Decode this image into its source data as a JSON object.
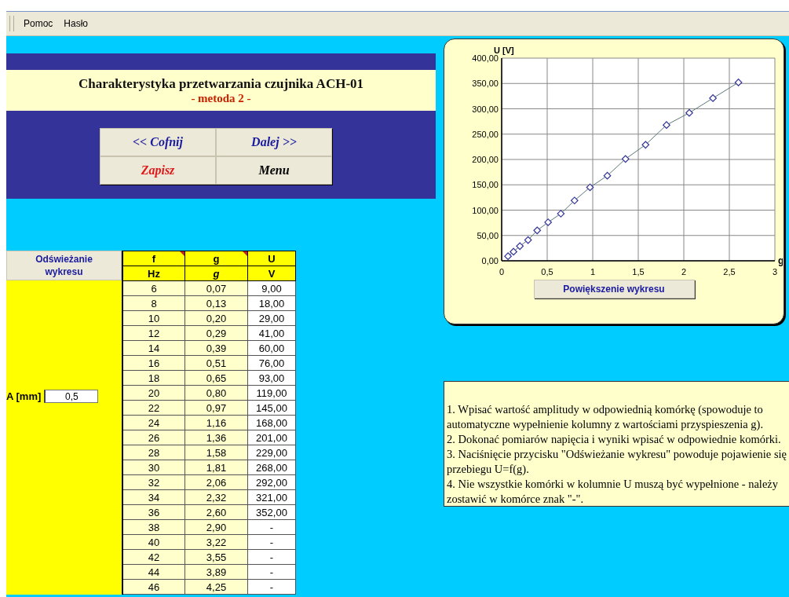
{
  "menu": [
    "Pomoc",
    "Hasło"
  ],
  "header": {
    "title": "Charakterystyka przetwarzania czujnika ACH-01",
    "subtitle": "- metoda 2 -"
  },
  "nav_buttons": [
    {
      "label": "<< Cofnij",
      "color": "#1a1aa0"
    },
    {
      "label": "Dalej >>",
      "color": "#1a1aa0"
    },
    {
      "label": "Zapisz",
      "color": "#e01818"
    },
    {
      "label": "Menu",
      "color": "#000000"
    }
  ],
  "refresh_button": "Odświeżanie wykresu",
  "amplitude": {
    "label": "A [mm]",
    "value": "0,5"
  },
  "table": {
    "columns": [
      {
        "name": "f",
        "unit": "Hz"
      },
      {
        "name": "g",
        "unit": "g"
      },
      {
        "name": "U",
        "unit": "V"
      }
    ],
    "rows": [
      [
        "6",
        "0,07",
        "9,00"
      ],
      [
        "8",
        "0,13",
        "18,00"
      ],
      [
        "10",
        "0,20",
        "29,00"
      ],
      [
        "12",
        "0,29",
        "41,00"
      ],
      [
        "14",
        "0,39",
        "60,00"
      ],
      [
        "16",
        "0,51",
        "76,00"
      ],
      [
        "18",
        "0,65",
        "93,00"
      ],
      [
        "20",
        "0,80",
        "119,00"
      ],
      [
        "22",
        "0,97",
        "145,00"
      ],
      [
        "24",
        "1,16",
        "168,00"
      ],
      [
        "26",
        "1,36",
        "201,00"
      ],
      [
        "28",
        "1,58",
        "229,00"
      ],
      [
        "30",
        "1,81",
        "268,00"
      ],
      [
        "32",
        "2,06",
        "292,00"
      ],
      [
        "34",
        "2,32",
        "321,00"
      ],
      [
        "36",
        "2,60",
        "352,00"
      ],
      [
        "38",
        "2,90",
        "-"
      ],
      [
        "40",
        "3,22",
        "-"
      ],
      [
        "42",
        "3,55",
        "-"
      ],
      [
        "44",
        "3,89",
        "-"
      ],
      [
        "46",
        "4,25",
        "-"
      ]
    ]
  },
  "chart": {
    "chart_data": {
      "type": "line",
      "xlabel": "g",
      "ylabel": "U [V]",
      "x": [
        0.07,
        0.13,
        0.2,
        0.29,
        0.39,
        0.51,
        0.65,
        0.8,
        0.97,
        1.16,
        1.36,
        1.58,
        1.81,
        2.06,
        2.32,
        2.6
      ],
      "series": [
        {
          "color": "#5a7a7a",
          "marker": "diamond",
          "values": [
            9,
            18,
            29,
            41,
            60,
            76,
            93,
            119,
            145,
            168,
            201,
            229,
            268,
            292,
            321,
            352
          ]
        }
      ],
      "grid": true,
      "xlim": [
        0,
        3
      ],
      "ylim": [
        0,
        400
      ],
      "xticks": [
        0,
        {
          "value": 0.5,
          "label": "0,5"
        },
        1,
        {
          "value": 1.5,
          "label": "1,5"
        },
        2,
        {
          "value": 2.5,
          "label": "2,5"
        },
        3
      ],
      "yticks": [
        {
          "value": 0,
          "label": "0,00"
        },
        {
          "value": 50,
          "label": "50,00"
        },
        {
          "value": 100,
          "label": "100,00"
        },
        {
          "value": 150,
          "label": "150,00"
        },
        {
          "value": 200,
          "label": "200,00"
        },
        {
          "value": 250,
          "label": "250,00"
        },
        {
          "value": 300,
          "label": "300,00"
        },
        {
          "value": 350,
          "label": "350,00"
        },
        {
          "value": 400,
          "label": "400,00"
        }
      ]
    },
    "zoom_button": "Powiększenie wykresu"
  },
  "instructions": [
    "1. Wpisać wartość amplitudy w odpowiednią komórkę (spowoduje to automatyczne wypełnienie kolumny z wartościami przyspieszenia g).",
    "2. Dokonać pomiarów napięcia i wyniki wpisać w odpowiednie komórki.",
    "3.  Naciśnięcie przycisku \"Odświeżanie wykresu\" powoduje pojawienie się przebiegu U=f(g).",
    "4. Nie wszystkie komórki w kolumnie U muszą być wypełnione - należy zostawić w komórce znak \"-\"."
  ]
}
